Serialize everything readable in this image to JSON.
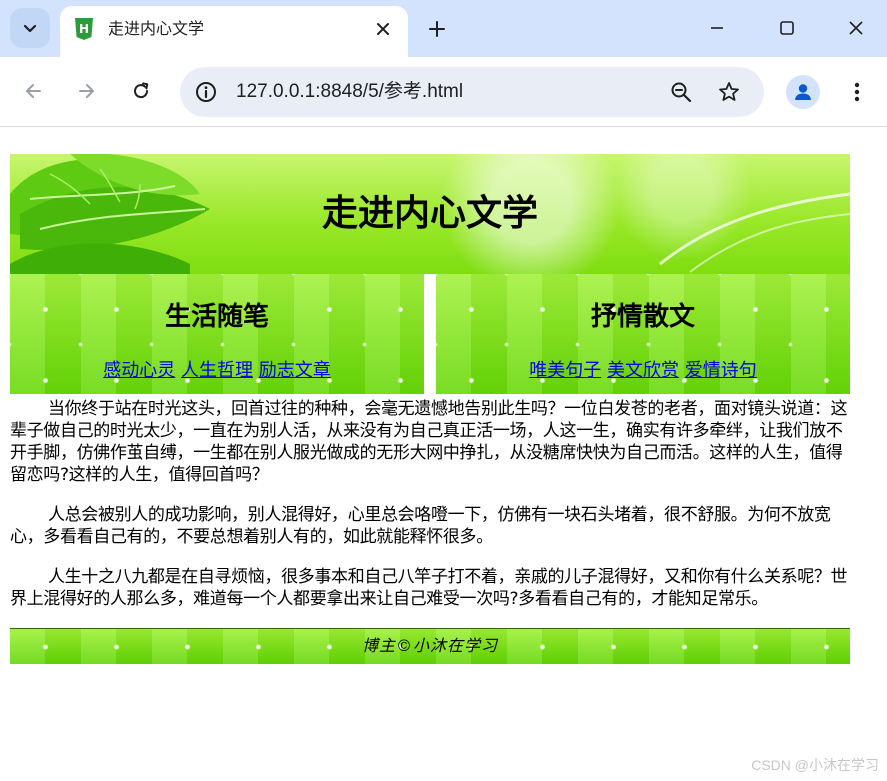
{
  "browser": {
    "tab_title": "走进内心文学",
    "url": "127.0.0.1:8848/5/参考.html",
    "favicon_letter": "H",
    "icons": {
      "tab_search": "chevron-down-icon",
      "tab_close": "close-icon",
      "new_tab": "plus-icon",
      "minimize": "minimize-icon",
      "maximize": "maximize-icon",
      "close_window": "close-icon",
      "back": "back-arrow-icon",
      "forward": "forward-arrow-icon",
      "reload": "reload-icon",
      "site_info": "info-icon",
      "zoom": "zoom-icon",
      "bookmark": "star-icon",
      "profile": "profile-icon",
      "menu": "more-vertical-icon"
    }
  },
  "banner": {
    "title": "走进内心文学"
  },
  "columns": [
    {
      "title": "生活随笔",
      "links": [
        "感动心灵",
        "人生哲理",
        "励志文章"
      ]
    },
    {
      "title": "抒情散文",
      "links": [
        "唯美句子",
        "美文欣赏",
        "爱情诗句"
      ]
    }
  ],
  "article": {
    "paragraphs": [
      "当你终于站在时光这头，回首过往的种种，会毫无遗憾地告别此生吗？一位白发苍的老者，面对镜头说道：这辈子做自己的时光太少，一直在为别人活，从来没有为自己真正活一场，人这一生，确实有许多牵绊，让我们放不开手脚，仿佛作茧自缚，一生都在别人服光做成的无形大网中挣扎，从没糖席快快为自己而活。这样的人生，值得留恋吗?这样的人生，值得回首吗？",
      "人总会被别人的成功影响，别人混得好，心里总会咯噔一下，仿佛有一块石头堵着，很不舒服。为何不放宽心，多看看自己有的，不要总想着别人有的，如此就能释怀很多。",
      "人生十之八九都是在自寻烦恼，很多事本和自己八竿子打不着，亲戚的儿子混得好，又和你有什么关系呢？世界上混得好的人那么多，难道每一个人都要拿出来让自己难受一次吗?多看看自己有的，才能知足常乐。"
    ]
  },
  "footer": {
    "text": "博主©小沐在学习"
  },
  "watermark": "CSDN @小沐在学习",
  "colors": {
    "tabbar_bg": "#d3e3fd",
    "accent_green": "#6fde0a",
    "link": "#0000ee"
  }
}
